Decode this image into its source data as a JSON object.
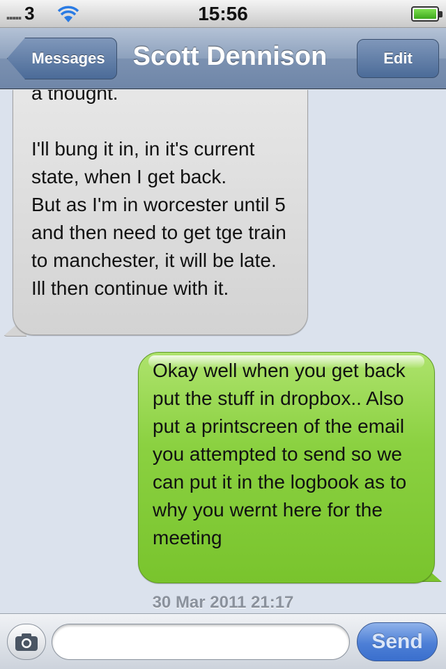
{
  "status_bar": {
    "signal": ".....",
    "carrier": "3",
    "wifi_icon": "wifi-icon",
    "time": "15:56",
    "battery_icon": "battery-icon",
    "battery_level": 1.0
  },
  "nav": {
    "back_label": "Messages",
    "title": "Scott Dennison",
    "edit_label": "Edit"
  },
  "messages": [
    {
      "direction": "incoming",
      "text": "a thought.\n\nI'll bung it in, in it's current state, when I get back.\nBut as I'm in worcester until 5 and then need to get tge train to manchester, it will be late.\nIll then continue with it."
    },
    {
      "direction": "outgoing",
      "text": "Okay well when you get back put the stuff in dropbox.. Also put a printscreen of the email you attempted to send so we can put it in the logbook as to why you wernt here for the meeting"
    }
  ],
  "timestamp": "30 Mar 2011 21:17",
  "compose": {
    "camera_icon": "camera-icon",
    "input_value": "",
    "send_label": "Send"
  },
  "colors": {
    "nav": "#7b91b1",
    "incoming_bubble": "#d8d8d8",
    "outgoing_bubble": "#86cc3b",
    "background": "#dbe2ed",
    "send": "#4d7fd6"
  }
}
